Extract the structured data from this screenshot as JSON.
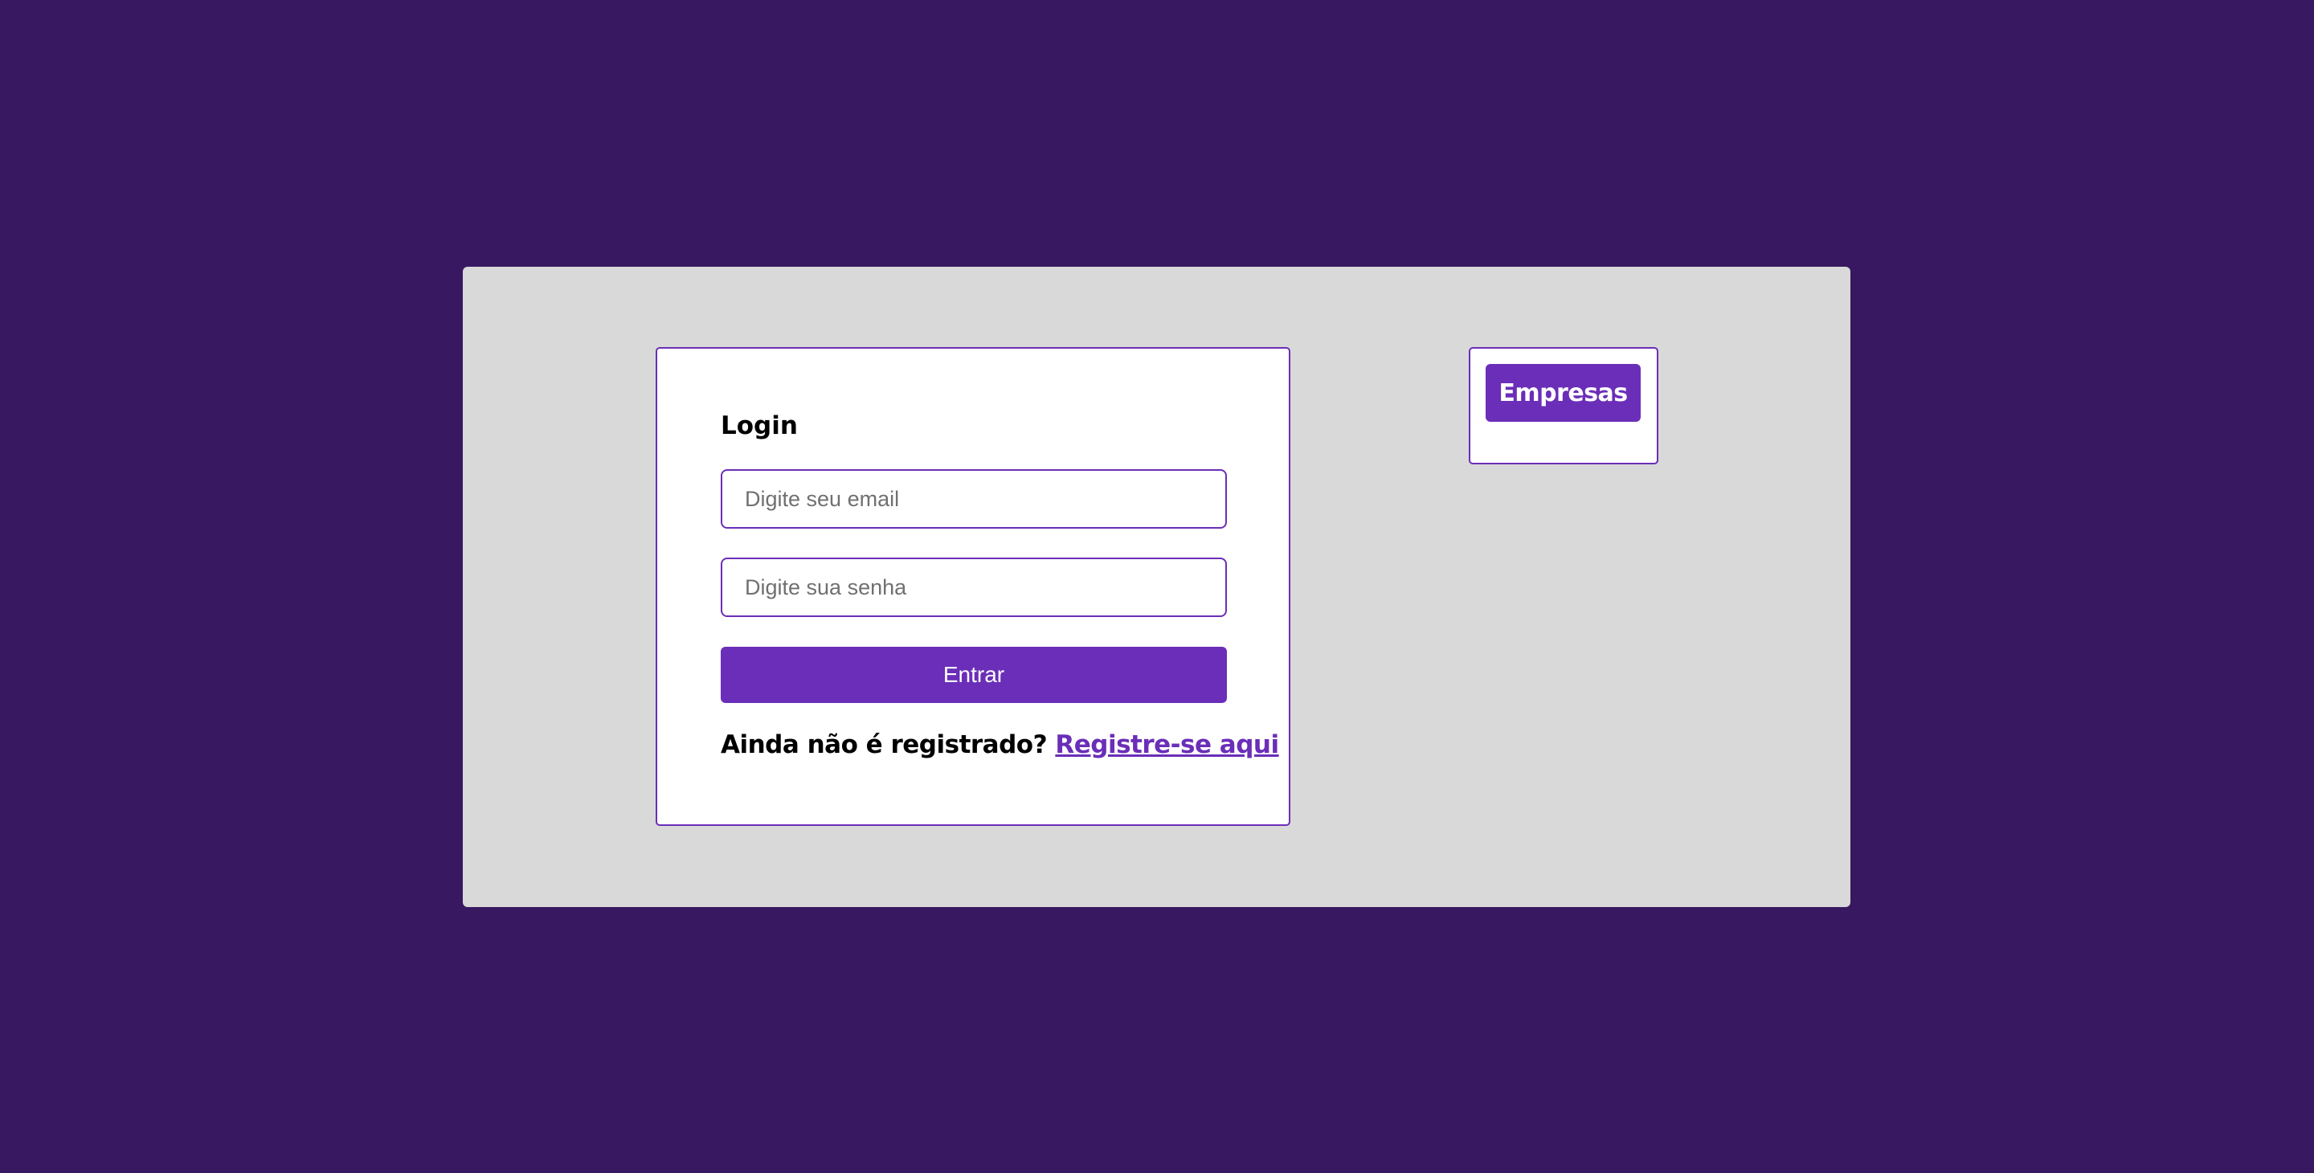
{
  "colors": {
    "page_background": "#381861",
    "panel_background": "#d9d9d9",
    "card_background": "#ffffff",
    "accent": "#6b2eb8"
  },
  "login": {
    "title": "Login",
    "email_placeholder": "Digite seu email",
    "email_value": "",
    "password_placeholder": "Digite sua senha",
    "password_value": "",
    "submit_label": "Entrar",
    "register_prompt": "Ainda não é registrado?",
    "register_link": "Registre-se aqui"
  },
  "companies": {
    "button_label": "Empresas"
  }
}
